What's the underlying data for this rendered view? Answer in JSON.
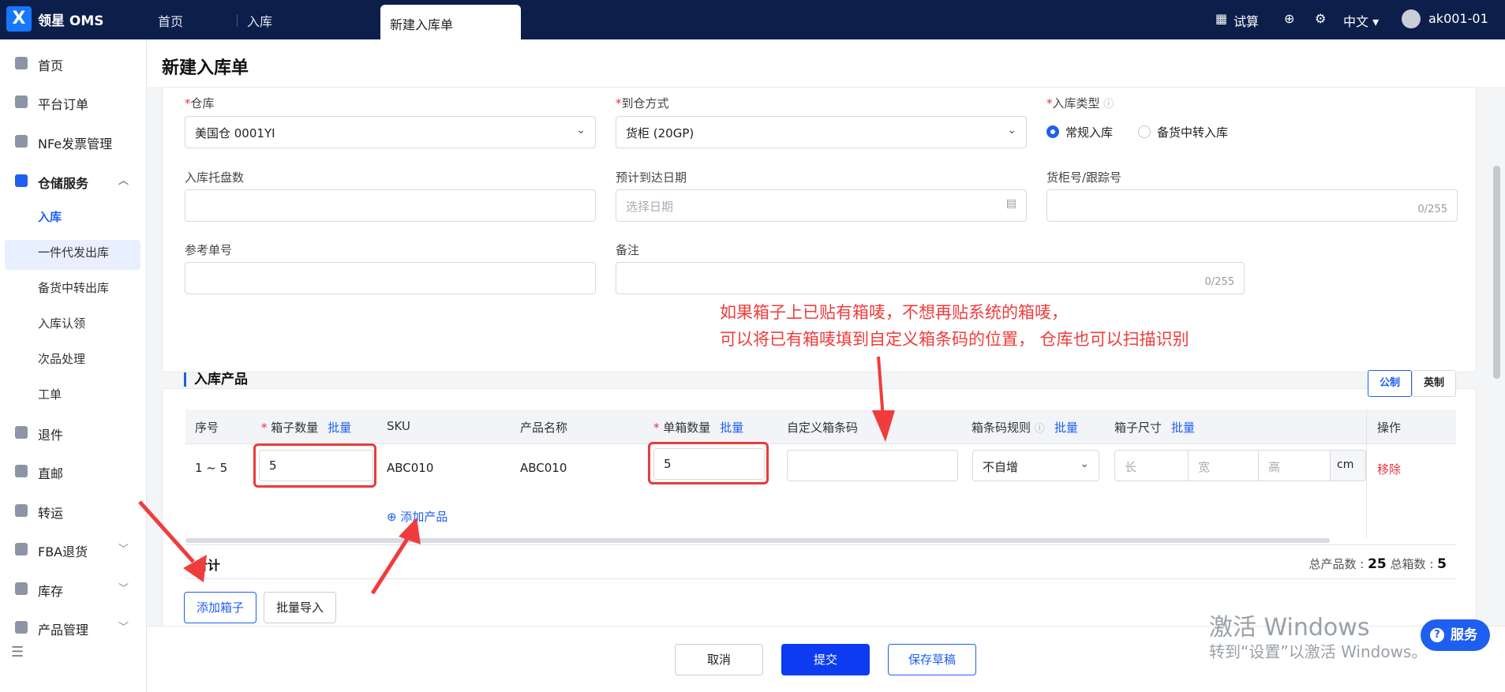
{
  "topbar": {
    "brand": "领星 OMS",
    "tabs": [
      "首页",
      "入库",
      "新建入库单"
    ],
    "trial": "试算",
    "language": "中文",
    "user": "ak001-01"
  },
  "sidebar": {
    "items": [
      {
        "label": "首页",
        "icon": "home-icon"
      },
      {
        "label": "平台订单",
        "icon": "clipboard-icon"
      },
      {
        "label": "NFe发票管理",
        "icon": "invoice-icon"
      },
      {
        "label": "仓储服务",
        "icon": "warehouse-icon"
      },
      {
        "label": "退件",
        "icon": "return-icon"
      },
      {
        "label": "直邮",
        "icon": "mail-icon"
      },
      {
        "label": "转运",
        "icon": "transfer-icon"
      },
      {
        "label": "FBA退货",
        "icon": "fba-icon"
      },
      {
        "label": "库存",
        "icon": "inventory-icon"
      },
      {
        "label": "产品管理",
        "icon": "product-icon"
      }
    ],
    "warehouse_sub": [
      "入库",
      "一件代发出库",
      "备货中转出库",
      "入库认领",
      "次品处理",
      "工单"
    ]
  },
  "page": {
    "title": "新建入库单"
  },
  "form": {
    "warehouse_label": "仓库",
    "warehouse_value": "美国仓 0001YI",
    "arrival_label": "到仓方式",
    "arrival_value": "货柜 (20GP)",
    "type_label": "入库类型",
    "type_options": [
      "常规入库",
      "备货中转入库"
    ],
    "pallet_label": "入库托盘数",
    "eta_label": "预计到达日期",
    "eta_placeholder": "选择日期",
    "container_label": "货柜号/跟踪号",
    "container_counter": "0/255",
    "ref_label": "参考单号",
    "remark_label": "备注",
    "remark_counter": "0/255"
  },
  "annotation": {
    "line1": "如果箱子上已贴有箱唛，不想再贴系统的箱唛，",
    "line2": "可以将已有箱唛填到自定义箱条码的位置， 仓库也可以扫描识别"
  },
  "products": {
    "title": "入库产品",
    "unit_metric": "公制",
    "unit_imperial": "英制",
    "headers": {
      "seq": "序号",
      "box_qty": "箱子数量",
      "sku": "SKU",
      "name": "产品名称",
      "per_box": "单箱数量",
      "custom_code": "自定义箱条码",
      "code_rule": "箱条码规则",
      "box_size": "箱子尺寸",
      "ops": "操作",
      "batch": "批量"
    },
    "row": {
      "seq": "1 ~ 5",
      "box_qty": "5",
      "sku": "ABC010",
      "name": "ABC010",
      "per_box": "5",
      "code_rule": "不自增",
      "len_ph": "长",
      "wid_ph": "宽",
      "hei_ph": "高",
      "unit": "cm",
      "remove": "移除"
    },
    "add_product": "添加产品",
    "sum_label": "合计",
    "total_products_label": "总产品数 :",
    "total_products": "25",
    "total_boxes_label": "总箱数 :",
    "total_boxes": "5"
  },
  "buttons": {
    "add_box": "添加箱子",
    "batch_import": "批量导入",
    "cancel": "取消",
    "submit": "提交",
    "save_draft": "保存草稿",
    "service": "服务"
  },
  "windows_watermark": {
    "line1": "激活 Windows",
    "line2": "转到“设置”以激活 Windows。"
  },
  "colors": {
    "accent": "#1f5ff0",
    "topbar": "#0c1f4a",
    "annotation": "#f03c3c"
  }
}
